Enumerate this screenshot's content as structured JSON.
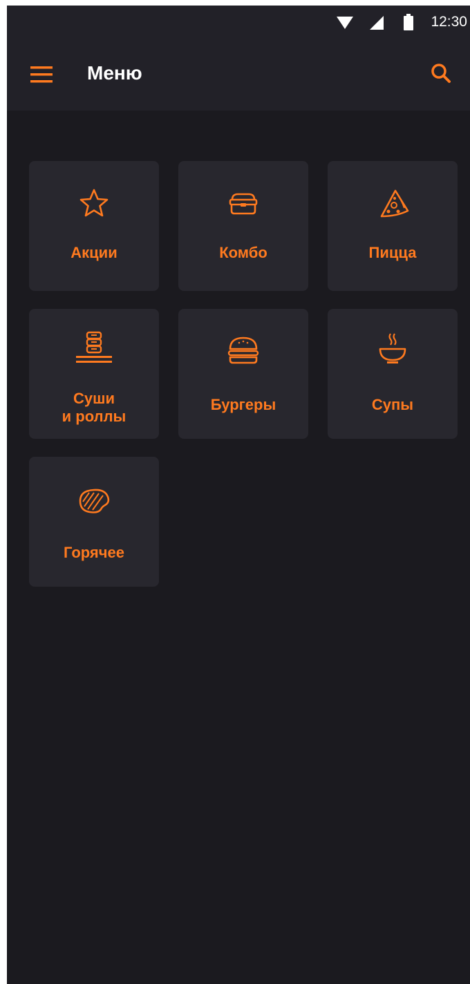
{
  "status_bar": {
    "time": "12:30",
    "icons": [
      "wifi-icon",
      "signal-icon",
      "battery-icon"
    ]
  },
  "toolbar": {
    "title": "Меню",
    "menu_icon": "hamburger-menu-icon",
    "search_icon": "search-icon"
  },
  "categories": [
    {
      "label": "Акции",
      "icon": "star-icon"
    },
    {
      "label": "Комбо",
      "icon": "lunchbox-icon"
    },
    {
      "label": "Пицца",
      "icon": "pizza-slice-icon"
    },
    {
      "label": "Суши\nи роллы",
      "icon": "sushi-rolls-icon"
    },
    {
      "label": "Бургеры",
      "icon": "burger-icon"
    },
    {
      "label": "Супы",
      "icon": "soup-bowl-icon"
    },
    {
      "label": "Горячее",
      "icon": "steak-icon"
    }
  ],
  "colors": {
    "accent": "#ff7a1f",
    "background": "#1b1a1f",
    "topbar": "#222128",
    "tile": "#28272e",
    "text": "#ffffff"
  }
}
